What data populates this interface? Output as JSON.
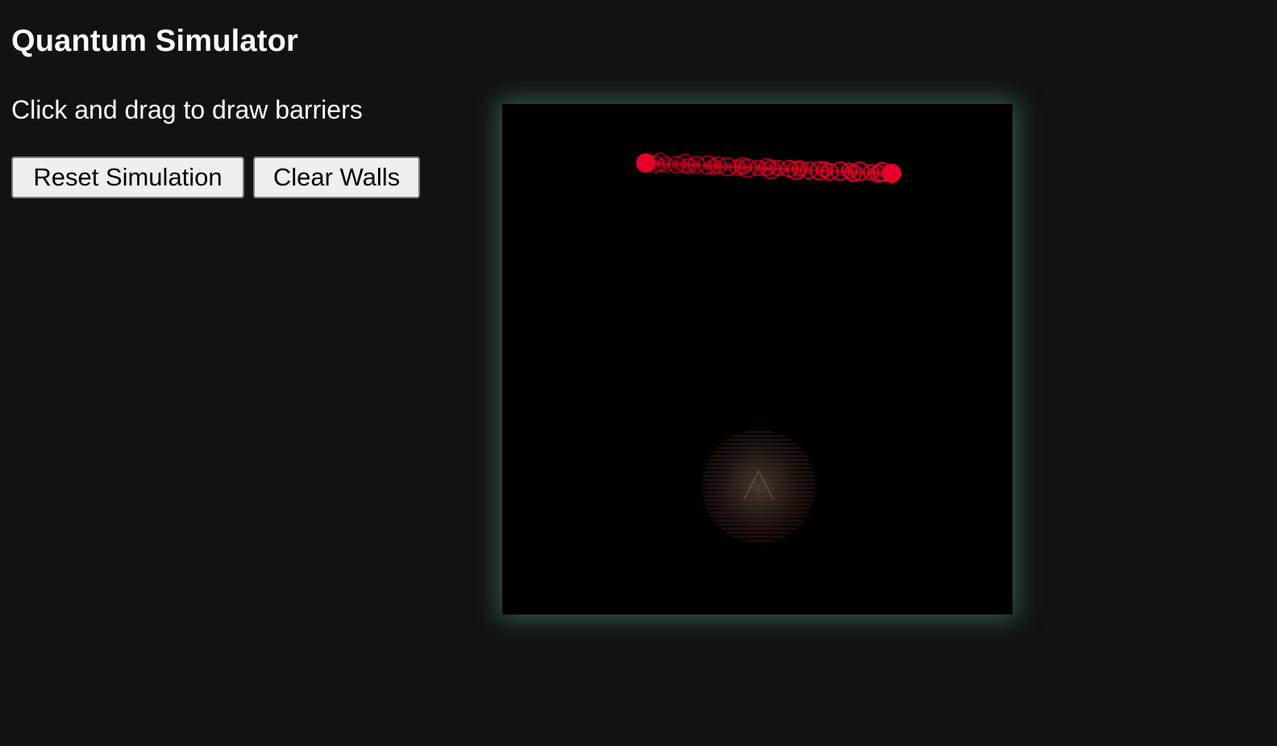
{
  "header": {
    "title": "Quantum Simulator",
    "instructions": "Click and drag to draw barriers"
  },
  "controls": {
    "reset_label": "Reset Simulation",
    "clear_label": "Clear Walls"
  },
  "simulation": {
    "background_color": "#000000",
    "glow_color": "#488c76",
    "particle_color": "#e8002a",
    "wavefunction_color": "#6b4a3a"
  }
}
